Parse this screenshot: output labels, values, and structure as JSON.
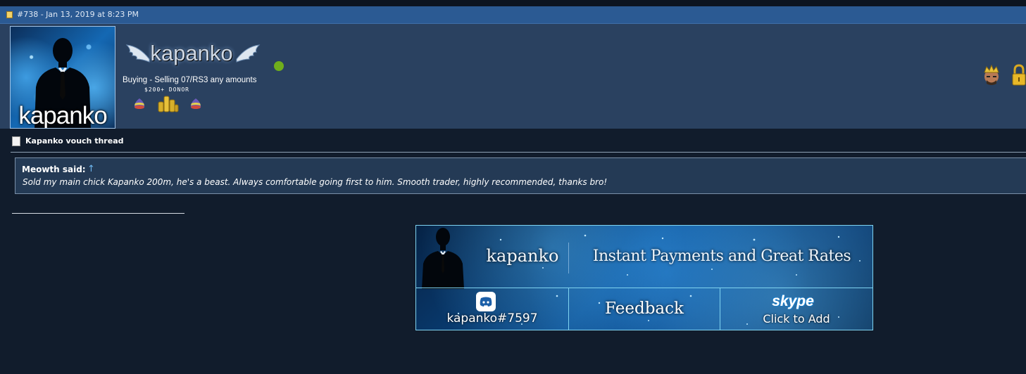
{
  "post": {
    "meta": "#738 - Jan 13, 2019 at 8:23 PM"
  },
  "user": {
    "avatar_text": "kapanko",
    "logo_text": "kapanko",
    "online_color": "#6fae1c",
    "title": "Buying - Selling 07/RS3 any amounts",
    "donor_label": "$200+ DONOR",
    "badges": [
      "rune-pouch-icon",
      "gold-coins-icon",
      "rune-pouch-icon"
    ],
    "header_icons": [
      "crowned-avatar-icon",
      "padlock-icon"
    ]
  },
  "thread": {
    "title": "Kapanko vouch thread"
  },
  "quote": {
    "author": "Meowth said:",
    "arrow": "↑",
    "body": "Sold my main chick Kapanko 200m, he's a beast. Always comfortable going first to him. Smooth trader, highly recommended, thanks bro!"
  },
  "signature": {
    "name": "kapanko",
    "tagline": "Instant Payments and Great Rates",
    "discord_handle": "kapanko#7597",
    "feedback_label": "Feedback",
    "skype_logo": "skype",
    "skype_cta": "Click to Add",
    "border_color": "#7fd3f0"
  }
}
